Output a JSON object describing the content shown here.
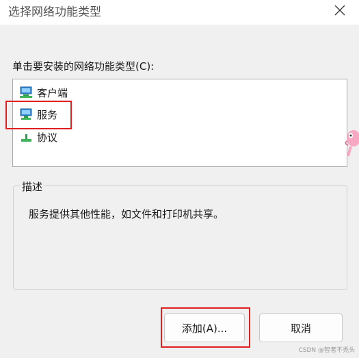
{
  "dialog": {
    "title": "选择网络功能类型",
    "prompt": "单击要安装的网络功能类型(C):"
  },
  "list": {
    "items": [
      {
        "label": "客户端",
        "icon": "client-computer-icon"
      },
      {
        "label": "服务",
        "icon": "service-computer-icon"
      },
      {
        "label": "协议",
        "icon": "protocol-icon"
      }
    ]
  },
  "description": {
    "group_title": "描述",
    "text": "服务提供其他性能，如文件和打印机共享。"
  },
  "buttons": {
    "add": "添加(A)...",
    "cancel": "取消"
  },
  "watermark": "CSDN @智者不秃头",
  "colors": {
    "highlight_box": "#e02020",
    "window_bg": "#f0f0f0"
  }
}
